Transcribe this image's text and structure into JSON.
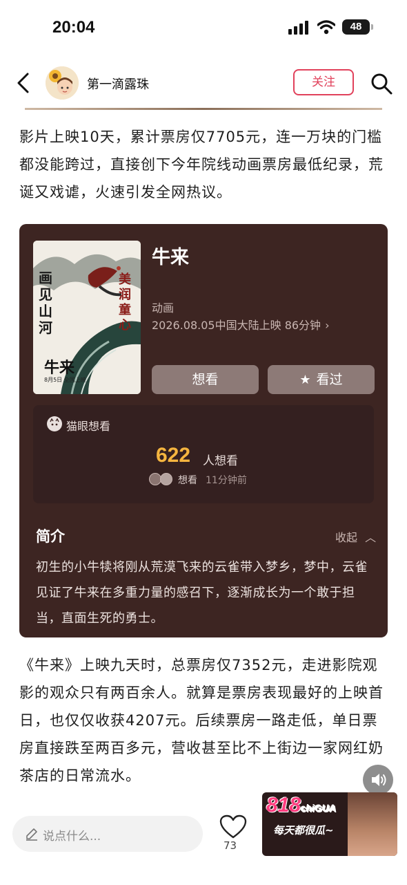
{
  "status": {
    "time": "20:04",
    "battery": "48"
  },
  "header": {
    "author": "第一滴露珠",
    "follow_label": "关注"
  },
  "article": {
    "paragraph1": "影片上映10天，累计票房仅7705元，连一万块的门槛都没能跨过，直接创下今年院线动画票房最低纪录，荒诞又戏谑，火速引发全网热议。",
    "paragraph2": "《牛来》上映九天时，总票房仅7352元，走进影院观影的观众只有两百余人。就算是票房表现最好的上映首日，也仅仅收获4207元。后续票房一路走低，单日票房直接跌至两百多元，营收甚至比不上街边一家网红奶茶店的日常流水。"
  },
  "movie": {
    "title": "牛来",
    "genre": "动画",
    "release": "2026.08.05中国大陆上映 86分钟",
    "want_label": "想看",
    "seen_label": "看过",
    "poster": {
      "title_left": "画见山河",
      "title_right": "美润童心",
      "name": "牛来",
      "date": "8月5日 全国上映"
    },
    "maoyan": {
      "brand": "猫眼想看",
      "count": "622",
      "count_unit": "人想看",
      "recent_action": "想看",
      "recent_time": "11分钟前"
    },
    "intro": {
      "heading": "简介",
      "collapse_label": "收起",
      "text": "初生的小牛犊将刚从荒漠飞来的云雀带入梦乡，梦中，云雀见证了牛来在多重力量的感召下，逐渐成长为一个敢于担当，直面生死的勇士。"
    }
  },
  "bottom": {
    "comment_placeholder": "说点什么...",
    "like_count": "73"
  },
  "ad": {
    "brand": "818",
    "brand_suffix": "chiGUA",
    "slogan": "每天都很瓜~"
  }
}
